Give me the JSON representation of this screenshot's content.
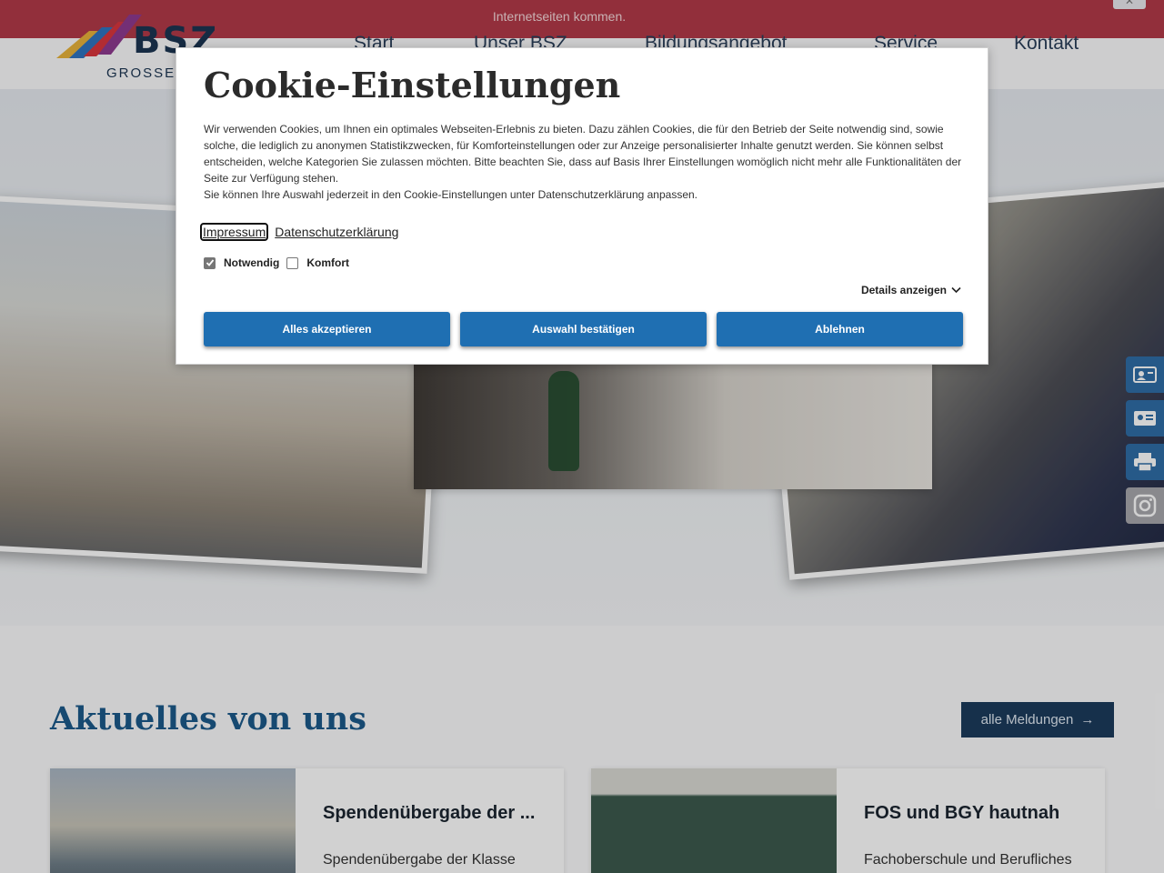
{
  "notice": {
    "text": "Internetseiten kommen.",
    "close_label": "✕"
  },
  "logo": {
    "word": "BSZ",
    "subtitle": "GROSSEN"
  },
  "nav": {
    "items": [
      "Start",
      "Unser BSZ",
      "Bildungsangebot",
      "Service",
      "Kontakt"
    ]
  },
  "news": {
    "title": "Aktuelles von uns",
    "all_label": "alle Meldungen",
    "all_arrow": "→",
    "cards": [
      {
        "title": "Spendenübergabe der ...",
        "text": "Spendenübergabe der Klasse"
      },
      {
        "title": "FOS und BGY hautnah",
        "text": "Fachoberschule und Berufliches"
      }
    ]
  },
  "side_tabs": [
    "contact-phone-icon",
    "contact-card-icon",
    "printer-icon",
    "instagram-icon"
  ],
  "cookie": {
    "title": "Cookie-Einstellungen",
    "paragraphs": [
      "Wir verwenden Cookies, um Ihnen ein optimales Webseiten-Erlebnis zu bieten. Dazu zählen Cookies, die für den Betrieb der Seite notwendig sind, sowie solche, die lediglich zu anonymen Statistikzwecken, für Komforteinstellungen oder zur Anzeige personalisierter Inhalte genutzt werden. Sie können selbst entscheiden, welche Kategorien Sie zulassen möchten. Bitte beachten Sie, dass auf Basis Ihrer Einstellungen womöglich nicht mehr alle Funktionalitäten der Seite zur Verfügung stehen.",
      "Sie können Ihre Auswahl jederzeit in den Cookie-Einstellungen unter Datenschutzerklärung anpassen."
    ],
    "links": {
      "impressum": "Impressum",
      "privacy": "Datenschutzerklärung"
    },
    "checkboxes": [
      {
        "label": "Notwendig",
        "checked": true
      },
      {
        "label": "Komfort",
        "checked": false
      }
    ],
    "details_label": "Details anzeigen",
    "buttons": {
      "accept_all": "Alles akzeptieren",
      "confirm": "Auswahl bestätigen",
      "decline": "Ablehnen"
    }
  },
  "colors": {
    "primary": "#1f6fb2",
    "heading": "#1c5a8a",
    "notice": "#b23a48",
    "dark": "#1c3b5c"
  }
}
